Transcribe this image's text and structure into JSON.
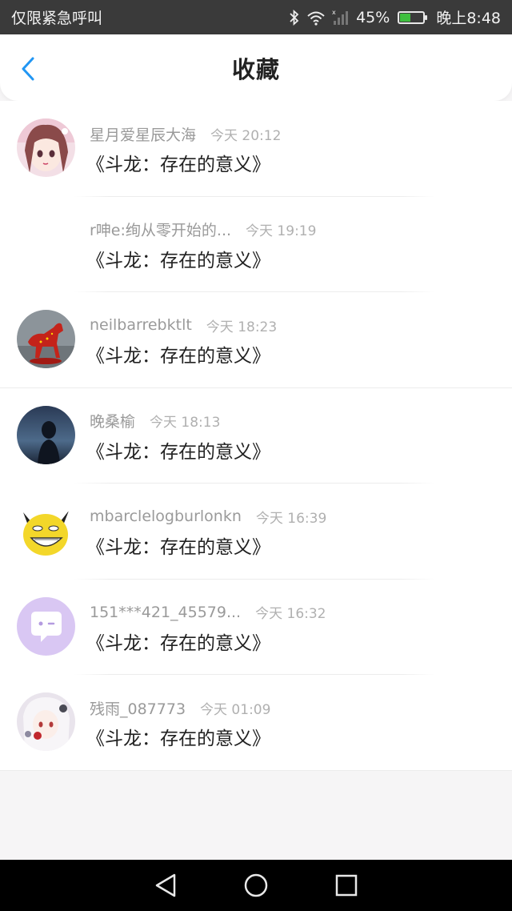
{
  "status_bar": {
    "carrier": "仅限紧急呼叫",
    "battery": "45%",
    "battery_level": 0.45,
    "time": "晚上8:48"
  },
  "header": {
    "title": "收藏"
  },
  "colors": {
    "accent": "#2196f3",
    "status_bar_bg": "#3a3a3a",
    "battery": "#3fbf3f"
  },
  "items": [
    {
      "username": "星月爱星辰大海",
      "time": "今天 20:12",
      "title": "《斗龙：存在的意义》",
      "avatar": "anime-girl-avatar"
    },
    {
      "username": "r呻e:绚从零开始的...",
      "time": "今天 19:19",
      "title": "《斗龙：存在的意义》",
      "avatar": ""
    },
    {
      "username": "neilbarrebktlt",
      "time": "今天 18:23",
      "title": "《斗龙：存在的意义》",
      "avatar": "red-horse-avatar"
    },
    {
      "username": "晚桑榆",
      "time": "今天 18:13",
      "title": "《斗龙：存在的意义》",
      "avatar": "night-silhouette-avatar"
    },
    {
      "username": "mbarclelogburlonkn",
      "time": "今天 16:39",
      "title": "《斗龙：存在的意义》",
      "avatar": "yellow-meme-avatar"
    },
    {
      "username": "151***421_45579...",
      "time": "今天 16:32",
      "title": "《斗龙：存在的意义》",
      "avatar": "chat-bubble-avatar"
    },
    {
      "username": "残雨_087773",
      "time": "今天 01:09",
      "title": "《斗龙：存在的意义》",
      "avatar": "anime-white-hair-avatar"
    }
  ]
}
